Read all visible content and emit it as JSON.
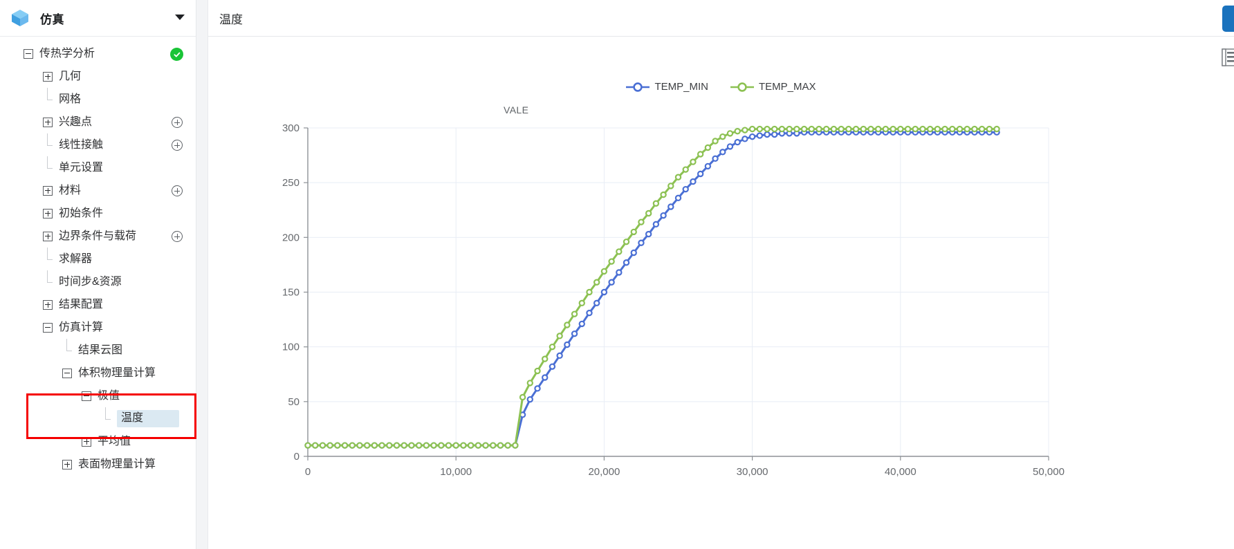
{
  "sidebar": {
    "app_title": "仿真",
    "logo_icon": "cube-icon",
    "caret_icon": "chevron-down-icon",
    "tree": [
      {
        "label": "传热学分析",
        "depth": 0,
        "marker": "minus",
        "status": "check",
        "add": false
      },
      {
        "label": "几何",
        "depth": 1,
        "marker": "plus",
        "status": "none",
        "add": false
      },
      {
        "label": "网格",
        "depth": 1,
        "marker": "leaf",
        "status": "none",
        "add": false
      },
      {
        "label": "兴趣点",
        "depth": 1,
        "marker": "plus",
        "status": "none",
        "add": true
      },
      {
        "label": "线性接触",
        "depth": 1,
        "marker": "leaf",
        "status": "none",
        "add": true
      },
      {
        "label": "单元设置",
        "depth": 1,
        "marker": "leaf",
        "status": "none",
        "add": false
      },
      {
        "label": "材料",
        "depth": 1,
        "marker": "plus",
        "status": "none",
        "add": true
      },
      {
        "label": "初始条件",
        "depth": 1,
        "marker": "plus",
        "status": "none",
        "add": false
      },
      {
        "label": "边界条件与载荷",
        "depth": 1,
        "marker": "plus",
        "status": "none",
        "add": true
      },
      {
        "label": "求解器",
        "depth": 1,
        "marker": "leaf",
        "status": "none",
        "add": false
      },
      {
        "label": "时间步&资源",
        "depth": 1,
        "marker": "leaf",
        "status": "none",
        "add": false
      },
      {
        "label": "结果配置",
        "depth": 1,
        "marker": "plus",
        "status": "none",
        "add": false
      },
      {
        "label": "仿真计算",
        "depth": 1,
        "marker": "minus",
        "status": "none",
        "add": false
      },
      {
        "label": "结果云图",
        "depth": 2,
        "marker": "leaf",
        "status": "none",
        "add": false
      },
      {
        "label": "体积物理量计算",
        "depth": 2,
        "marker": "minus",
        "status": "none",
        "add": false
      },
      {
        "label": "极值",
        "depth": 3,
        "marker": "minus",
        "status": "none",
        "add": false
      },
      {
        "label": "温度",
        "depth": 4,
        "marker": "leaf",
        "status": "none",
        "add": false,
        "selected": true
      },
      {
        "label": "平均值",
        "depth": 3,
        "marker": "plus",
        "status": "none",
        "add": false
      },
      {
        "label": "表面物理量计算",
        "depth": 2,
        "marker": "plus",
        "status": "none",
        "add": false
      }
    ],
    "highlight_color": "#f50000"
  },
  "main": {
    "panel_title": "温度",
    "top_action_icon": "action-button",
    "side_tool_icon": "table-view-icon",
    "accent_color": "#1a72bd"
  },
  "chart_data": {
    "type": "line",
    "title": "",
    "xlabel": "",
    "ylabel": "VALE",
    "xlim": [
      0,
      50000
    ],
    "ylim": [
      0,
      300
    ],
    "xticks": [
      0,
      10000,
      20000,
      30000,
      40000,
      50000
    ],
    "xticklabels": [
      "0",
      "10,000",
      "20,000",
      "30,000",
      "40,000",
      "50,000"
    ],
    "yticks": [
      0,
      50,
      100,
      150,
      200,
      250,
      300
    ],
    "yticklabels": [
      "0",
      "50",
      "100",
      "150",
      "200",
      "250",
      "300"
    ],
    "grid": true,
    "legend_position": "top-center",
    "markers": "circle",
    "series": [
      {
        "name": "TEMP_MIN",
        "color": "#4a6fd4",
        "x": [
          0,
          500,
          1000,
          1500,
          2000,
          2500,
          3000,
          3500,
          4000,
          4500,
          5000,
          5500,
          6000,
          6500,
          7000,
          7500,
          8000,
          8500,
          9000,
          9500,
          10000,
          10500,
          11000,
          11500,
          12000,
          12500,
          13000,
          13500,
          14000,
          14500,
          15000,
          15500,
          16000,
          16500,
          17000,
          17500,
          18000,
          18500,
          19000,
          19500,
          20000,
          20500,
          21000,
          21500,
          22000,
          22500,
          23000,
          23500,
          24000,
          24500,
          25000,
          25500,
          26000,
          26500,
          27000,
          27500,
          28000,
          28500,
          29000,
          29500,
          30000,
          30500,
          31000,
          31500,
          32000,
          32500,
          33000,
          33500,
          34000,
          34500,
          35000,
          35500,
          36000,
          36500,
          37000,
          37500,
          38000,
          38500,
          39000,
          39500,
          40000,
          40500,
          41000,
          41500,
          42000,
          42500,
          43000,
          43500,
          44000,
          44500,
          45000,
          45500,
          46000,
          46500
        ],
        "y": [
          10,
          10,
          10,
          10,
          10,
          10,
          10,
          10,
          10,
          10,
          10,
          10,
          10,
          10,
          10,
          10,
          10,
          10,
          10,
          10,
          10,
          10,
          10,
          10,
          10,
          10,
          10,
          10,
          10,
          38,
          52,
          62,
          72,
          82,
          92,
          102,
          112,
          121,
          131,
          140,
          150,
          159,
          168,
          177,
          186,
          195,
          203,
          212,
          220,
          228,
          236,
          244,
          251,
          258,
          265,
          272,
          278,
          283,
          287,
          290,
          292,
          293,
          294,
          294,
          295,
          295,
          295,
          296,
          296,
          296,
          296,
          296,
          296,
          296,
          296,
          296,
          296,
          296,
          296,
          296,
          296,
          296,
          296,
          296,
          296,
          296,
          296,
          296,
          296,
          296,
          296,
          296,
          296,
          296
        ]
      },
      {
        "name": "TEMP_MAX",
        "color": "#8cc152",
        "x": [
          0,
          500,
          1000,
          1500,
          2000,
          2500,
          3000,
          3500,
          4000,
          4500,
          5000,
          5500,
          6000,
          6500,
          7000,
          7500,
          8000,
          8500,
          9000,
          9500,
          10000,
          10500,
          11000,
          11500,
          12000,
          12500,
          13000,
          13500,
          14000,
          14500,
          15000,
          15500,
          16000,
          16500,
          17000,
          17500,
          18000,
          18500,
          19000,
          19500,
          20000,
          20500,
          21000,
          21500,
          22000,
          22500,
          23000,
          23500,
          24000,
          24500,
          25000,
          25500,
          26000,
          26500,
          27000,
          27500,
          28000,
          28500,
          29000,
          29500,
          30000,
          30500,
          31000,
          31500,
          32000,
          32500,
          33000,
          33500,
          34000,
          34500,
          35000,
          35500,
          36000,
          36500,
          37000,
          37500,
          38000,
          38500,
          39000,
          39500,
          40000,
          40500,
          41000,
          41500,
          42000,
          42500,
          43000,
          43500,
          44000,
          44500,
          45000,
          45500,
          46000,
          46500
        ],
        "y": [
          10,
          10,
          10,
          10,
          10,
          10,
          10,
          10,
          10,
          10,
          10,
          10,
          10,
          10,
          10,
          10,
          10,
          10,
          10,
          10,
          10,
          10,
          10,
          10,
          10,
          10,
          10,
          10,
          10,
          54,
          67,
          78,
          89,
          100,
          110,
          120,
          130,
          140,
          150,
          159,
          169,
          178,
          187,
          196,
          205,
          214,
          222,
          231,
          239,
          247,
          255,
          262,
          269,
          276,
          282,
          288,
          292,
          295,
          297,
          298,
          299,
          299,
          299,
          299,
          299,
          299,
          299,
          299,
          299,
          299,
          299,
          299,
          299,
          299,
          299,
          299,
          299,
          299,
          299,
          299,
          299,
          299,
          299,
          299,
          299,
          299,
          299,
          299,
          299,
          299,
          299,
          299,
          299,
          299
        ]
      }
    ]
  }
}
